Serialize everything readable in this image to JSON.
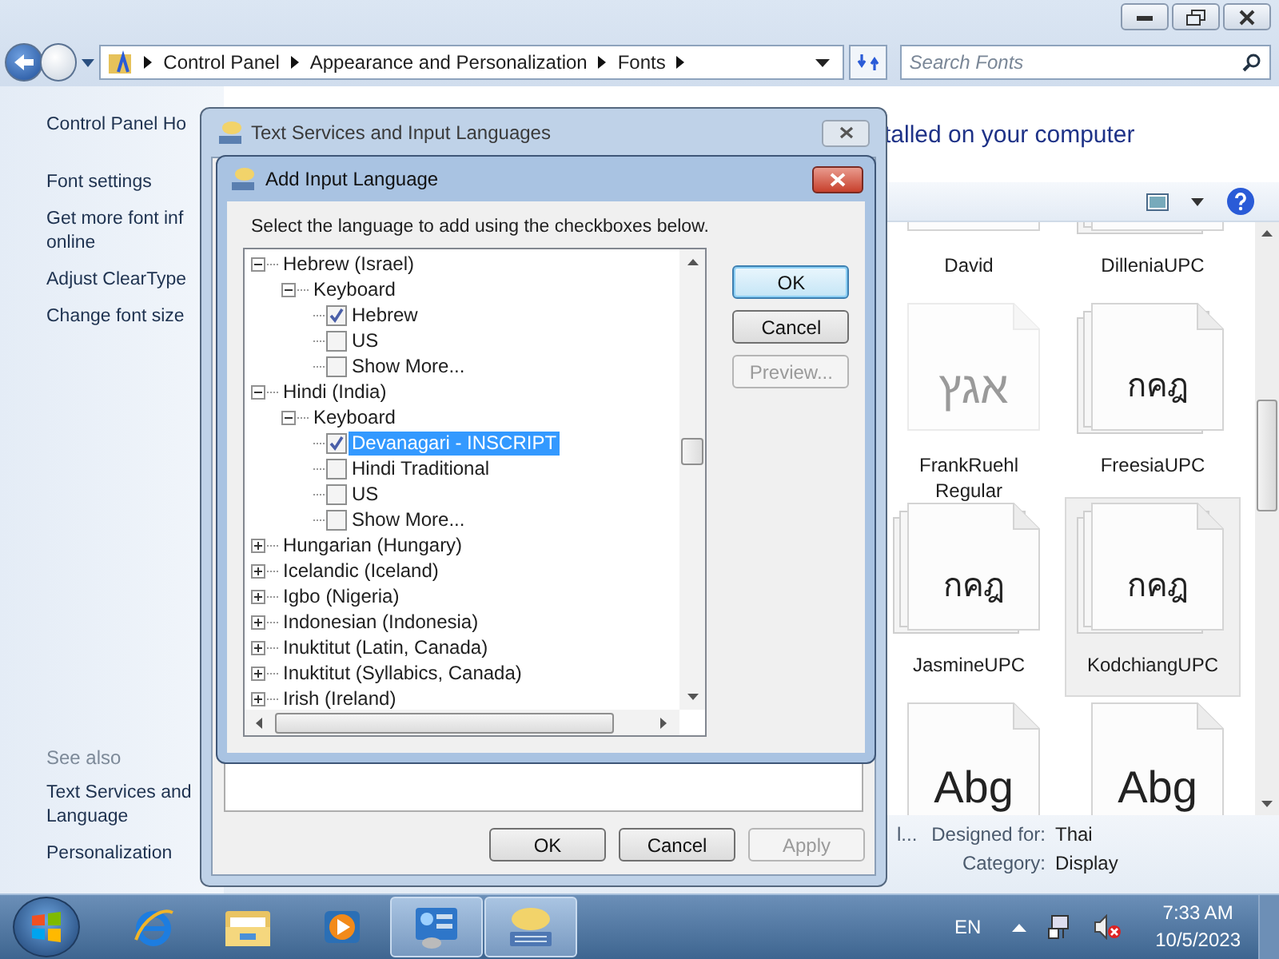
{
  "explorer": {
    "breadcrumbs": [
      "Control Panel",
      "Appearance and Personalization",
      "Fonts"
    ],
    "search": {
      "placeholder": "Search Fonts"
    },
    "sidebar": {
      "items": [
        {
          "lines": [
            "Control Panel Ho"
          ],
          "kind": "home"
        },
        {
          "lines": [
            "Font settings"
          ],
          "kind": "link"
        },
        {
          "lines": [
            "Get more font inf",
            "online"
          ],
          "kind": "link"
        },
        {
          "lines": [
            "Adjust ClearType"
          ],
          "kind": "link"
        },
        {
          "lines": [
            "Change font size"
          ],
          "kind": "link"
        }
      ]
    },
    "see_also": {
      "title": "See also",
      "items": [
        {
          "lines": [
            "Text Services and",
            "Language"
          ]
        },
        {
          "lines": [
            "Personalization"
          ]
        }
      ]
    },
    "heading": "talled on your computer",
    "fonts": [
      {
        "name": "David",
        "stacked": false,
        "hidden": false,
        "selected": false
      },
      {
        "name": "DilleniaUPC",
        "stacked": true,
        "hidden": false,
        "selected": false
      },
      {
        "name": "FrankRuehl Regular",
        "sample": "אגץ",
        "stacked": false,
        "hidden": true,
        "selected": false
      },
      {
        "name": "FreesiaUPC",
        "sample": "กคฎ",
        "stacked": true,
        "hidden": false,
        "selected": false
      },
      {
        "name": "JasmineUPC",
        "sample": "กคฎ",
        "stacked": true,
        "hidden": false,
        "selected": false
      },
      {
        "name": "KodchiangUPC",
        "sample": "กคฎ",
        "stacked": true,
        "hidden": false,
        "selected": true
      },
      {
        "sample": "Abg",
        "stacked": false,
        "hidden": false,
        "selected": false
      },
      {
        "sample": "Abg",
        "stacked": false,
        "hidden": false,
        "selected": false
      }
    ],
    "details": {
      "cut_text": "l...",
      "fields": [
        {
          "label": "Designed for:",
          "value": "Thai"
        },
        {
          "label": "Category:",
          "value": "Display"
        }
      ]
    }
  },
  "text_services_dialog": {
    "title": "Text Services and Input Languages",
    "buttons": [
      {
        "label": "OK",
        "disabled": false
      },
      {
        "label": "Cancel",
        "disabled": false
      },
      {
        "label": "Apply",
        "disabled": true
      }
    ]
  },
  "add_language_dialog": {
    "title": "Add Input Language",
    "instruction": "Select the language to add using the checkboxes below.",
    "tree": [
      {
        "kind": "language",
        "label": "Hebrew (Israel)",
        "expanded": true,
        "selected": false,
        "children": [
          {
            "kind": "group",
            "label": "Keyboard",
            "expanded": true,
            "selected": false,
            "children": [
              {
                "kind": "layout",
                "label": "Hebrew",
                "checked": true,
                "selected": false
              },
              {
                "kind": "layout",
                "label": "US",
                "checked": false,
                "selected": false
              },
              {
                "kind": "layout",
                "label": "Show More...",
                "checked": false,
                "selected": false
              }
            ]
          }
        ]
      },
      {
        "kind": "language",
        "label": "Hindi (India)",
        "expanded": true,
        "selected": false,
        "children": [
          {
            "kind": "group",
            "label": "Keyboard",
            "expanded": true,
            "selected": false,
            "children": [
              {
                "kind": "layout",
                "label": "Devanagari - INSCRIPT",
                "checked": true,
                "selected": true
              },
              {
                "kind": "layout",
                "label": "Hindi Traditional",
                "checked": false,
                "selected": false
              },
              {
                "kind": "layout",
                "label": "US",
                "checked": false,
                "selected": false
              },
              {
                "kind": "layout",
                "label": "Show More...",
                "checked": false,
                "selected": false
              }
            ]
          }
        ]
      },
      {
        "kind": "language",
        "label": "Hungarian (Hungary)",
        "expanded": false,
        "selected": false
      },
      {
        "kind": "language",
        "label": "Icelandic (Iceland)",
        "expanded": false,
        "selected": false
      },
      {
        "kind": "language",
        "label": "Igbo (Nigeria)",
        "expanded": false,
        "selected": false
      },
      {
        "kind": "language",
        "label": "Indonesian (Indonesia)",
        "expanded": false,
        "selected": false
      },
      {
        "kind": "language",
        "label": "Inuktitut (Latin, Canada)",
        "expanded": false,
        "selected": false
      },
      {
        "kind": "language",
        "label": "Inuktitut (Syllabics, Canada)",
        "expanded": false,
        "selected": false
      },
      {
        "kind": "language",
        "label": "Irish (Ireland)",
        "expanded": false,
        "selected": false
      }
    ],
    "buttons": [
      {
        "label": "OK",
        "default": true,
        "disabled": false
      },
      {
        "label": "Cancel",
        "default": false,
        "disabled": false
      },
      {
        "label": "Preview...",
        "default": false,
        "disabled": true
      }
    ]
  },
  "taskbar": {
    "apps": [
      {
        "kind": "browser",
        "active": false
      },
      {
        "kind": "folder",
        "active": false
      },
      {
        "kind": "media",
        "active": false
      },
      {
        "kind": "control_panel",
        "active": true
      },
      {
        "kind": "keyboard",
        "active": true
      }
    ],
    "language": "EN",
    "time": "7:33 AM",
    "date": "10/5/2023"
  }
}
